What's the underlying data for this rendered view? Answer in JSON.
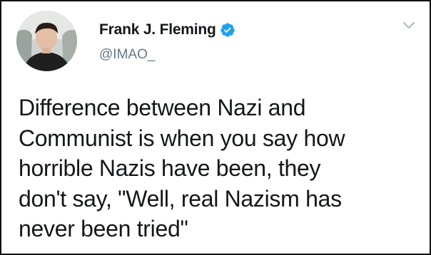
{
  "tweet": {
    "author": {
      "display_name": "Frank J. Fleming",
      "handle": "@IMAO_",
      "verified": true,
      "avatar_icon": "profile-photo"
    },
    "text": "Difference between Nazi and\nCommunist is when you say how\nhorrible Nazis have been, they\ndon't say, \"Well, real Nazism has\nnever been tried\"",
    "menu_icon": "chevron-down-icon"
  },
  "colors": {
    "verified_badge": "#1da1f2",
    "name_text": "#14171a",
    "handle_text": "#657786"
  }
}
